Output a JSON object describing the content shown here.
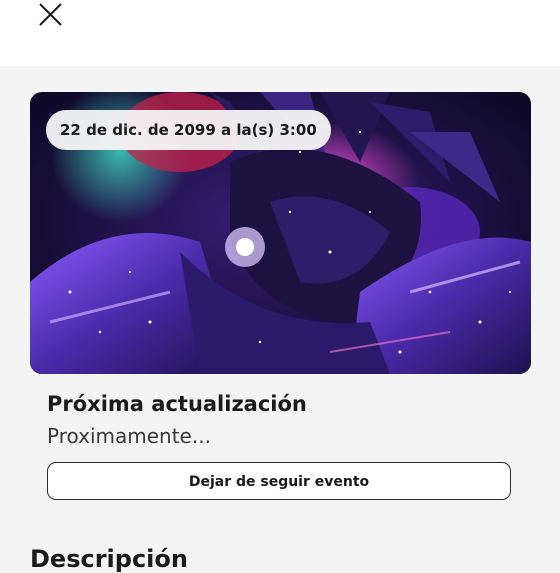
{
  "header": {
    "close_icon": "close-icon"
  },
  "event": {
    "date_label": "22 de dic. de 2099 a la(s) 3:00",
    "title": "Próxima actualización",
    "subtitle": "Proximamente...",
    "unfollow_label": "Dejar de seguir evento"
  },
  "description": {
    "heading": "Descripción"
  }
}
